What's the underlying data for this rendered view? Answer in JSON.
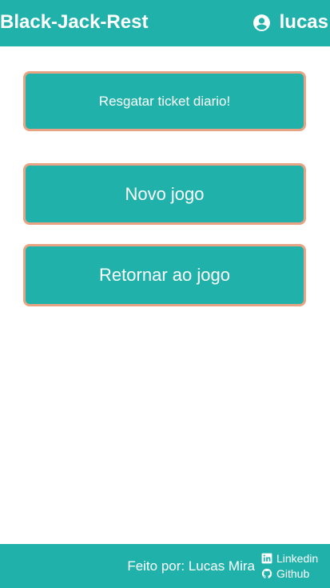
{
  "header": {
    "title": "Black-Jack-Rest",
    "user_icon": "account-circle-icon",
    "username": "lucas"
  },
  "actions": {
    "claim_ticket": "Resgatar ticket diario!",
    "new_game": "Novo jogo",
    "return_game": "Retornar ao jogo"
  },
  "footer": {
    "credit": "Feito por: Lucas Mira",
    "links": [
      {
        "label": "Linkedin",
        "icon": "linkedin-icon"
      },
      {
        "label": "Github",
        "icon": "github-icon"
      }
    ]
  },
  "colors": {
    "primary": "#20b2aa",
    "button_border": "#e8a384",
    "text": "#ffffff"
  }
}
